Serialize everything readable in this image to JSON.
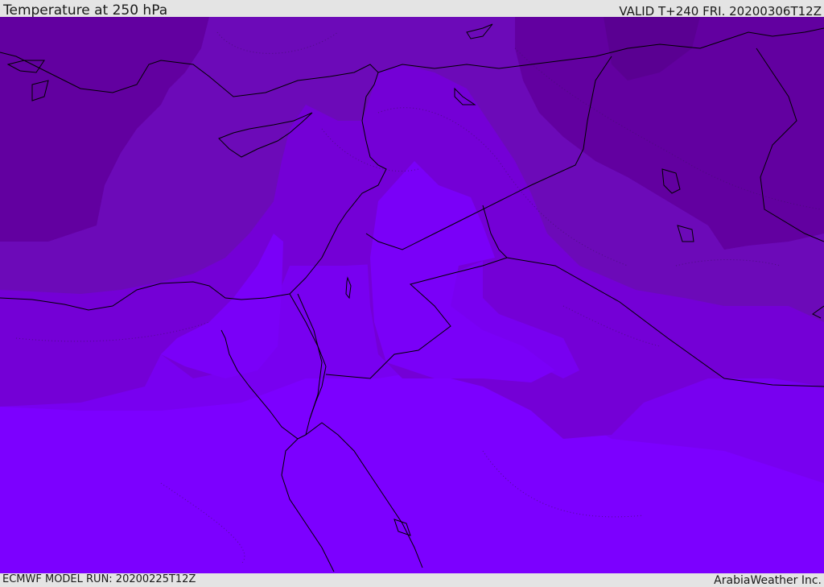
{
  "header": {
    "title": "Temperature at 250 hPa",
    "valid": "VALID T+240 FRI. 20200306T12Z"
  },
  "footer": {
    "model_run": "ECMWF MODEL RUN: 20200225T12Z",
    "credit": "ArabiaWeather Inc."
  },
  "map": {
    "region": "Eastern Mediterranean and Middle East",
    "field": "temperature",
    "colors": {
      "coldest": "#6200a0",
      "colder": "#6c0ab8",
      "mid": "#7400d6",
      "warm": "#7800f0",
      "warmest": "#7c00ff",
      "coastline": "#000000"
    }
  }
}
